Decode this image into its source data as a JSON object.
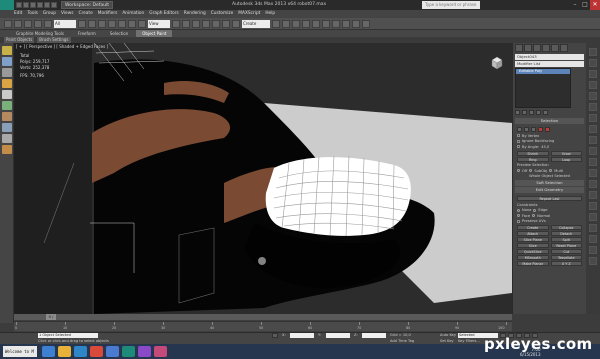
{
  "window": {
    "workspace": "Workspace: Default",
    "title": "Autodesk 3ds Max  2013 x64     robot07.max",
    "search_placeholder": "Type a keyword or phrase",
    "controls": [
      "–",
      "□",
      "✕"
    ]
  },
  "menubar": {
    "items": [
      "Edit",
      "Tools",
      "Group",
      "Views",
      "Create",
      "Modifiers",
      "Animation",
      "Graph Editors",
      "Rendering",
      "Customize",
      "MAXScript",
      "Help"
    ]
  },
  "toolbar": {
    "view_dropdown": "View",
    "selection_dropdown": "Create Selection Se"
  },
  "ribbon": {
    "tabs": [
      "Graphite Modeling Tools",
      "Freeform",
      "Selection",
      "Object Paint"
    ],
    "active_tab": "Object Paint",
    "subtabs": [
      "Paint Objects",
      "Brush Settings"
    ]
  },
  "viewport": {
    "label": "[ + ] [ Perspective ] [ Shaded + Edged Faces ]",
    "stats_total": "Total",
    "stats_polys_label": "Polys:",
    "stats_polys": "259,717",
    "stats_verts_label": "Verts:",
    "stats_verts": "252,378",
    "stats_fps_label": "FPS:",
    "stats_fps": "70,796"
  },
  "command_panel": {
    "object_name": "Object043",
    "modifier_list": "Modifier List",
    "stack_item": "Editable Poly",
    "rollouts": {
      "selection": "Selection",
      "by_vertex": "By Vertex",
      "ignore_backfacing": "Ignore Backfacing",
      "by_angle": "By Angle:",
      "by_angle_value": "45,0",
      "shrink": "Shrink",
      "grow": "Grow",
      "ring": "Ring",
      "loop": "Loop",
      "preview_selection": "Preview Selection",
      "off": "Off",
      "subobj": "SubObj",
      "multi": "Multi",
      "whole_object_selected": "Whole Object Selected",
      "soft_selection": "Soft Selection",
      "edit_geometry": "Edit Geometry",
      "repeat_last": "Repeat Last",
      "constraints": "Constraints",
      "none": "None",
      "edge": "Edge",
      "face": "Face",
      "normal": "Normal",
      "preserve_uvs": "Preserve UVs",
      "create": "Create",
      "collapse": "Collapse",
      "attach": "Attach",
      "detach": "Detach",
      "slice_plane": "Slice Plane",
      "split": "Split",
      "slice": "Slice",
      "reset_plane": "Reset Plane",
      "quickslice": "QuickSlice",
      "cut": "Cut",
      "msmooth": "MSmooth",
      "tessellate": "Tessellate",
      "make_planar": "Make Planar",
      "xyz": "X  Y  Z"
    }
  },
  "timeline": {
    "frame_counter": "0 / 100",
    "ticks": [
      "0",
      "10",
      "20",
      "30",
      "40",
      "50",
      "60",
      "70",
      "80",
      "90",
      "100"
    ]
  },
  "statusbar": {
    "selection_info": "1 Object Selected",
    "prompt": "Click or click-and-drag to select objects",
    "auto_key": "Auto Key",
    "selected": "Selected",
    "set_key": "Set Key",
    "key_filters": "Key Filters...",
    "add_time_tag": "Add Time Tag",
    "x_label": "X:",
    "y_label": "Y:",
    "z_label": "Z:",
    "grid": "Grid = 10,0"
  },
  "taskbar": {
    "welcome": "Welcome to M",
    "date": "6/15/2013",
    "time": "7:00"
  },
  "watermark": {
    "text": "pxleyes.com",
    "sub": ""
  },
  "colors": {
    "background": "#3c3c3c",
    "viewport": "#2a2a2a",
    "selection": "#5c84b8",
    "mesh_brown": "#7a4a33"
  }
}
